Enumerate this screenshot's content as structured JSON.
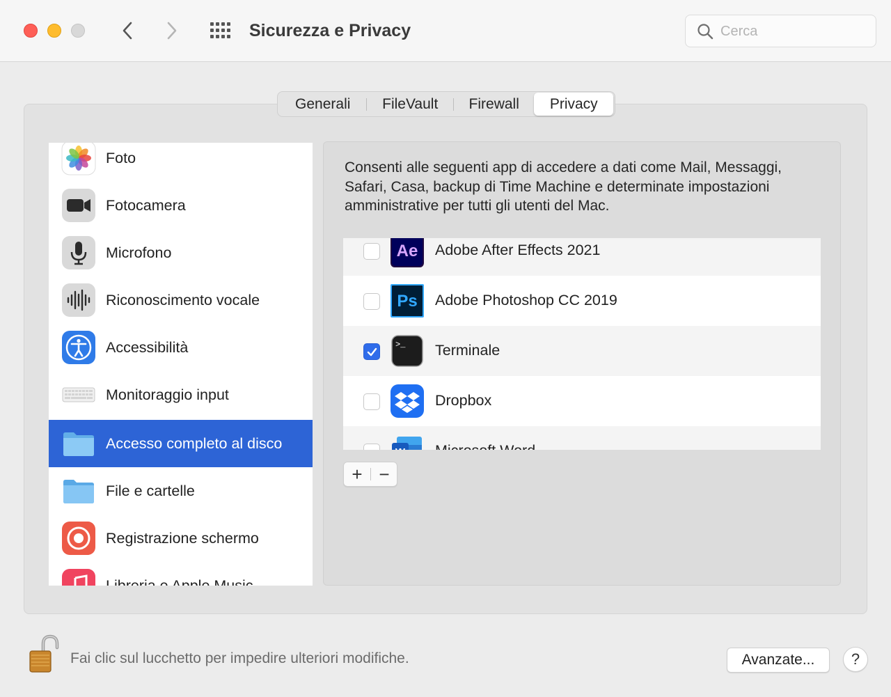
{
  "window": {
    "title": "Sicurezza e Privacy"
  },
  "search": {
    "placeholder": "Cerca",
    "value": ""
  },
  "tabs": [
    {
      "label": "Generali"
    },
    {
      "label": "FileVault"
    },
    {
      "label": "Firewall"
    },
    {
      "label": "Privacy",
      "selected": true
    }
  ],
  "categories": [
    {
      "label": "Foto",
      "icon": "photos-icon"
    },
    {
      "label": "Fotocamera",
      "icon": "camera-icon"
    },
    {
      "label": "Microfono",
      "icon": "microphone-icon"
    },
    {
      "label": "Riconoscimento vocale",
      "icon": "speech-recognition-icon"
    },
    {
      "label": "Accessibilità",
      "icon": "accessibility-icon"
    },
    {
      "label": "Monitoraggio input",
      "icon": "keyboard-icon"
    },
    {
      "label": "Accesso completo al disco",
      "icon": "folder-icon",
      "selected": true
    },
    {
      "label": "File e cartelle",
      "icon": "folder-icon"
    },
    {
      "label": "Registrazione schermo",
      "icon": "screen-recording-icon"
    },
    {
      "label": "Libreria e Apple Music",
      "icon": "music-icon"
    }
  ],
  "detail": {
    "description": "Consenti alle seguenti app di accedere a dati come Mail, Messaggi, Safari, Casa, backup di Time Machine e determinate impostazioni amministrative per tutti gli utenti del Mac.",
    "apps": [
      {
        "label": "Adobe After Effects 2021",
        "icon": "after-effects-icon",
        "checked": false
      },
      {
        "label": "Adobe Photoshop CC 2019",
        "icon": "photoshop-icon",
        "checked": false
      },
      {
        "label": "Terminale",
        "icon": "terminal-icon",
        "checked": true
      },
      {
        "label": "Dropbox",
        "icon": "dropbox-icon",
        "checked": false
      },
      {
        "label": "Microsoft Word",
        "icon": "word-icon",
        "checked": false
      }
    ],
    "add_label": "+",
    "remove_label": "−"
  },
  "footer": {
    "lock_message": "Fai clic sul lucchetto per impedire ulteriori modifiche.",
    "advanced_label": "Avanzate...",
    "help_label": "?"
  },
  "colors": {
    "selection": "#2d64d6",
    "checkbox_on": "#2f6cea",
    "close": "#fe5f57",
    "minimize": "#febc2e"
  }
}
